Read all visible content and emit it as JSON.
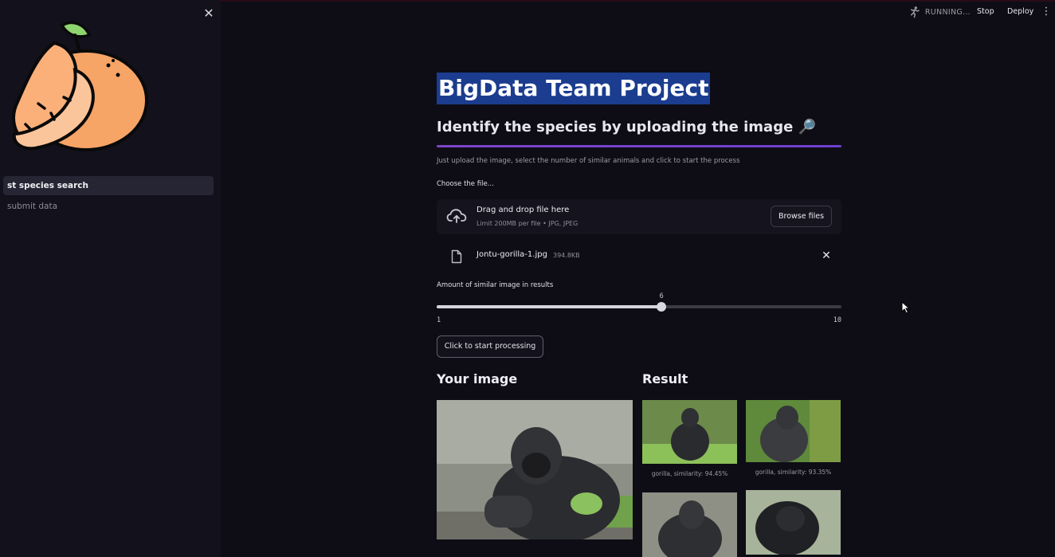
{
  "sidebar": {
    "nav": [
      {
        "label": "st species search",
        "active": true
      },
      {
        "label": "submit data",
        "active": false
      }
    ]
  },
  "header": {
    "status": "RUNNING...",
    "stop_label": "Stop",
    "deploy_label": "Deploy"
  },
  "main": {
    "title": "BigData Team Project",
    "subtitle": "Identify the species by uploading the image 🔎",
    "caption": "Just upload the image, select the number of similar animals and click to start the process",
    "uploader": {
      "label": "Choose the file...",
      "drop_text": "Drag and drop file here",
      "limit_text": "Limit 200MB per file • JPG, JPEG",
      "browse_label": "Browse files",
      "file_name": "Jontu-gorilla-1.jpg",
      "file_size": "394.8KB"
    },
    "slider": {
      "label": "Amount of similar image in results",
      "value": "6",
      "min": "1",
      "max": "10"
    },
    "process_label": "Click to start processing",
    "your_image_heading": "Your image",
    "result_heading": "Result",
    "results": [
      {
        "caption": "gorilla, similarity: 94.45%"
      },
      {
        "caption": "gorilla, similarity: 93.35%"
      },
      {
        "caption": ""
      },
      {
        "caption": ""
      }
    ]
  },
  "colors": {
    "background": "#0e0d16",
    "sidebar": "#12111c",
    "accent_divider": "#7d45c9",
    "title_highlight": "#1b3c8f"
  }
}
